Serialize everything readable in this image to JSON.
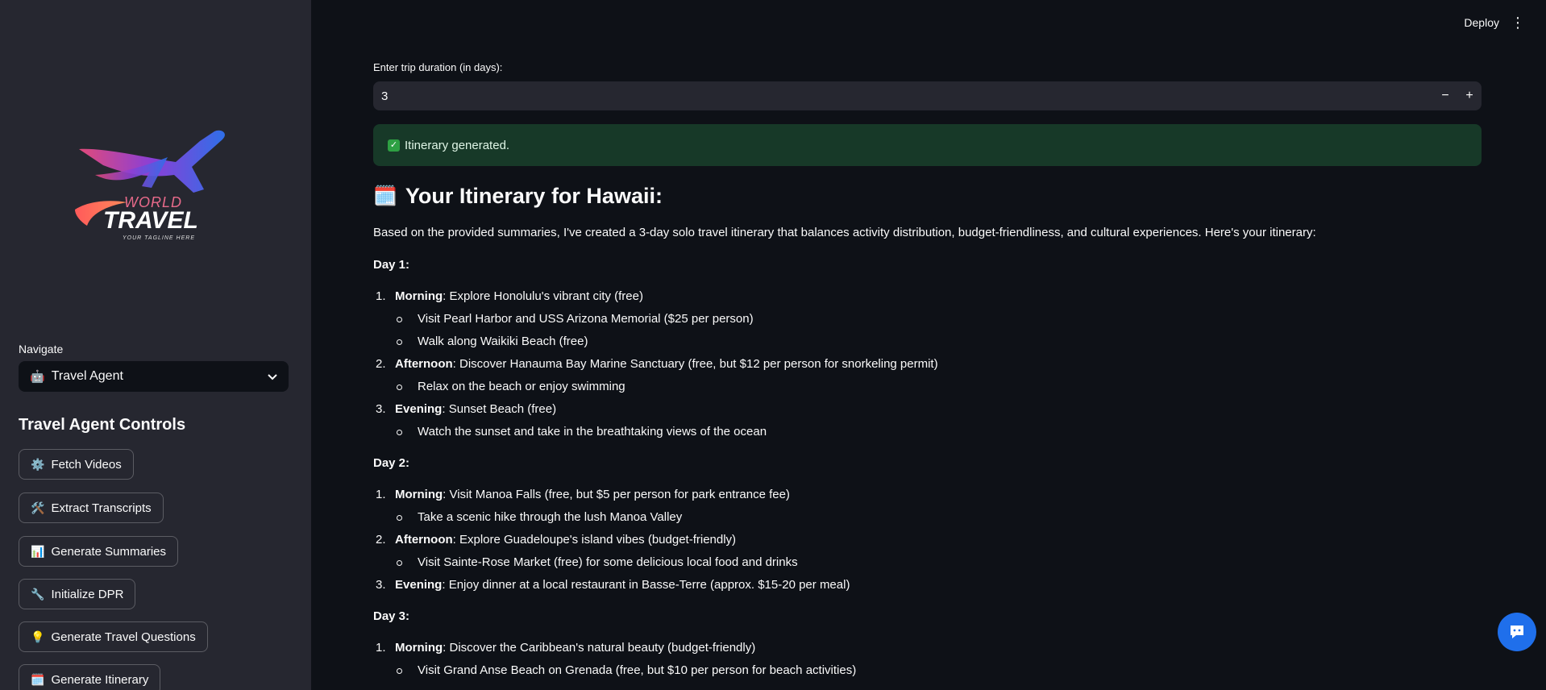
{
  "sidebar": {
    "logo": {
      "line1": "WORLD",
      "line2": "TRAVEL",
      "tagline": "YOUR TAGLINE HERE"
    },
    "nav_label": "Navigate",
    "nav_select": {
      "emoji": "🤖",
      "value": "Travel Agent"
    },
    "controls_title": "Travel Agent Controls",
    "buttons": [
      {
        "emoji": "⚙️",
        "label": "Fetch Videos"
      },
      {
        "emoji": "🛠️",
        "label": "Extract Transcripts"
      },
      {
        "emoji": "📊",
        "label": "Generate Summaries"
      },
      {
        "emoji": "🔧",
        "label": "Initialize DPR"
      },
      {
        "emoji": "💡",
        "label": "Generate Travel Questions"
      },
      {
        "emoji": "🗓️",
        "label": "Generate Itinerary"
      }
    ]
  },
  "header": {
    "deploy": "Deploy",
    "menu_icon": "⋮"
  },
  "main": {
    "duration_label": "Enter trip duration (in days):",
    "duration_value": "3",
    "minus": "−",
    "plus": "+",
    "success_text": "Itinerary generated.",
    "title_emoji": "🗓️",
    "title": "Your Itinerary for Hawaii:",
    "intro": "Based on the provided summaries, I've created a 3-day solo travel itinerary that balances activity distribution, budget-friendliness, and cultural experiences. Here's your itinerary:",
    "days": [
      {
        "label": "Day 1:",
        "items": [
          {
            "time": "Morning",
            "text": ": Explore Honolulu's vibrant city (free)",
            "subs": [
              "Visit Pearl Harbor and USS Arizona Memorial ($25 per person)",
              "Walk along Waikiki Beach (free)"
            ]
          },
          {
            "time": "Afternoon",
            "text": ": Discover Hanauma Bay Marine Sanctuary (free, but $12 per person for snorkeling permit)",
            "subs": [
              "Relax on the beach or enjoy swimming"
            ]
          },
          {
            "time": "Evening",
            "text": ": Sunset Beach (free)",
            "subs": [
              "Watch the sunset and take in the breathtaking views of the ocean"
            ]
          }
        ]
      },
      {
        "label": "Day 2:",
        "items": [
          {
            "time": "Morning",
            "text": ": Visit Manoa Falls (free, but $5 per person for park entrance fee)",
            "subs": [
              "Take a scenic hike through the lush Manoa Valley"
            ]
          },
          {
            "time": "Afternoon",
            "text": ": Explore Guadeloupe's island vibes (budget-friendly)",
            "subs": [
              "Visit Sainte-Rose Market (free) for some delicious local food and drinks"
            ]
          },
          {
            "time": "Evening",
            "text": ": Enjoy dinner at a local restaurant in Basse-Terre (approx. $15-20 per meal)",
            "subs": []
          }
        ]
      },
      {
        "label": "Day 3:",
        "items": [
          {
            "time": "Morning",
            "text": ": Discover the Caribbean's natural beauty (budget-friendly)",
            "subs": [
              "Visit Grand Anse Beach on Grenada (free, but $10 per person for beach activities)"
            ]
          }
        ]
      }
    ]
  },
  "colors": {
    "sidebar_bg": "#262730",
    "main_bg": "#0e1117",
    "success_bg": "#173928",
    "accent": "#1f6feb"
  }
}
